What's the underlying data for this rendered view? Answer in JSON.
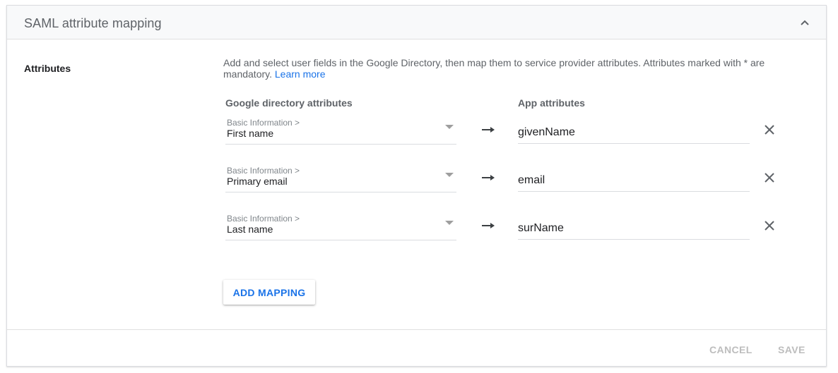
{
  "panel": {
    "title": "SAML attribute mapping",
    "collapse_icon": "chevron-up-icon"
  },
  "section": {
    "label": "Attributes",
    "description": "Add and select user fields in the Google Directory, then map them to service provider attributes. Attributes marked with * are mandatory.",
    "learn_more": "Learn more"
  },
  "columns": {
    "directory": "Google directory attributes",
    "app": "App attributes"
  },
  "mappings": [
    {
      "category": "Basic Information >",
      "field": "First name",
      "app_attribute": "givenName"
    },
    {
      "category": "Basic Information >",
      "field": "Primary email",
      "app_attribute": "email"
    },
    {
      "category": "Basic Information >",
      "field": "Last name",
      "app_attribute": "surName"
    }
  ],
  "icons": {
    "arrow": "arrow-right-icon",
    "remove": "close-icon",
    "dropdown": "caret-down-icon"
  },
  "actions": {
    "add_mapping": "ADD MAPPING",
    "cancel": "CANCEL",
    "save": "SAVE"
  },
  "colors": {
    "accent": "#1a73e8",
    "disabled": "#bdbdbd",
    "header_bg": "#f8f9fa"
  }
}
